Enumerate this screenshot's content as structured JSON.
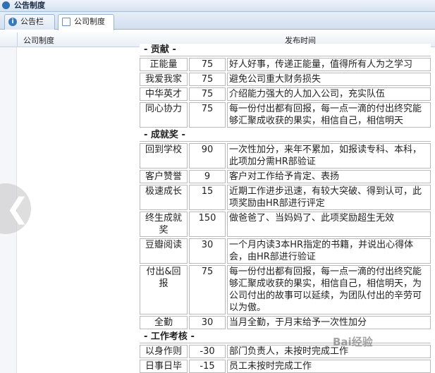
{
  "window": {
    "title": "公告制度"
  },
  "tabs": [
    {
      "label": "公告栏",
      "icon": "info-icon",
      "active": false
    },
    {
      "label": "公司制度",
      "icon": "document-icon",
      "active": true
    }
  ],
  "list": {
    "col_title": "公司制度",
    "col_date": "发布时间"
  },
  "rules": {
    "sections": [
      {
        "title": "- 贡献 -",
        "rows": [
          {
            "name": "正能量",
            "score": "75",
            "desc": "好人好事，传递正能量，值得所有人为之学习"
          },
          {
            "name": "我爱我家",
            "score": "75",
            "desc": "避免公司重大财务损失"
          },
          {
            "name": "中华英才",
            "score": "75",
            "desc": "介绍能力强大的人加入公司，充实队伍"
          },
          {
            "name": "同心协力",
            "score": "75",
            "desc": "每一份付出都有回报，每一点一滴的付出终究能够汇聚成收获的果实，相信自己，相信明天"
          }
        ]
      },
      {
        "title": "- 成就奖 -",
        "rows": [
          {
            "name": "回到学校",
            "score": "90",
            "desc": "一次性加分，来年不累加，如报读专科、本科，此项加分需HR部验证"
          },
          {
            "name": "客户赞誉",
            "score": "9",
            "desc": "客户对工作给予肯定、表扬"
          },
          {
            "name": "极速成长",
            "score": "15",
            "desc": "近期工作进步迅速，有较大突破、得到认可，此项奖励由HR部进行评定"
          },
          {
            "name": "终生成就奖",
            "score": "150",
            "desc": "做爸爸了、当妈妈了、此项奖励超生无效"
          },
          {
            "name": "豆瓣阅读",
            "score": "30",
            "desc": "一个月内读3本HR指定的书籍，并说出心得体会，由HR部进行验证"
          },
          {
            "name": "付出&回报",
            "score": "75",
            "desc": "每一份付出都有回报，每一点一滴的付出终究能够汇聚成收获的果实，相信自己，相信明天，为公司付出的故事可以延续，为团队付出的辛劳可以为傲。"
          },
          {
            "name": "全勤",
            "score": "30",
            "desc": "当月全勤，于月末给予一次性加分"
          }
        ]
      },
      {
        "title": "- 工作考核 -",
        "rows": [
          {
            "name": "以身作则",
            "score": "-30",
            "desc": "部门负责人，未按时完成工作"
          },
          {
            "name": "日事日毕",
            "score": "-15",
            "desc": "员工未按时完成工作"
          }
        ]
      }
    ]
  },
  "watermark": {
    "text": "Bai经验"
  },
  "colors": {
    "accent": "#2f6fb3",
    "tab_bg": "#d2dff0",
    "cell_border": "#b9b9b9"
  }
}
